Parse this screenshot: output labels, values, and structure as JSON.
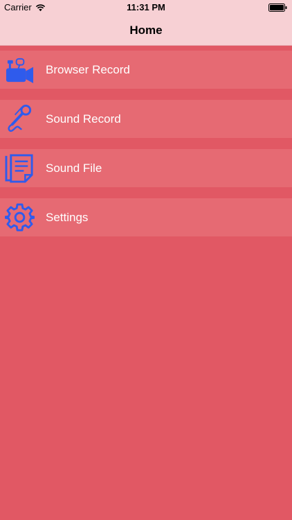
{
  "status_bar": {
    "carrier": "Carrier",
    "time": "11:31 PM",
    "wifi_icon": "wifi-icon",
    "battery_icon": "battery-icon"
  },
  "nav": {
    "title": "Home"
  },
  "menu": {
    "items": [
      {
        "label": "Browser Record",
        "icon": "video-camera-icon"
      },
      {
        "label": "Sound Record",
        "icon": "microphone-icon"
      },
      {
        "label": "Sound File",
        "icon": "document-icon"
      },
      {
        "label": "Settings",
        "icon": "gear-icon"
      }
    ]
  },
  "colors": {
    "background": "#e15864",
    "row": "#e66a73",
    "nav_bar": "#f7d0d4",
    "icon": "#2f5bec",
    "label": "#ffffff"
  }
}
